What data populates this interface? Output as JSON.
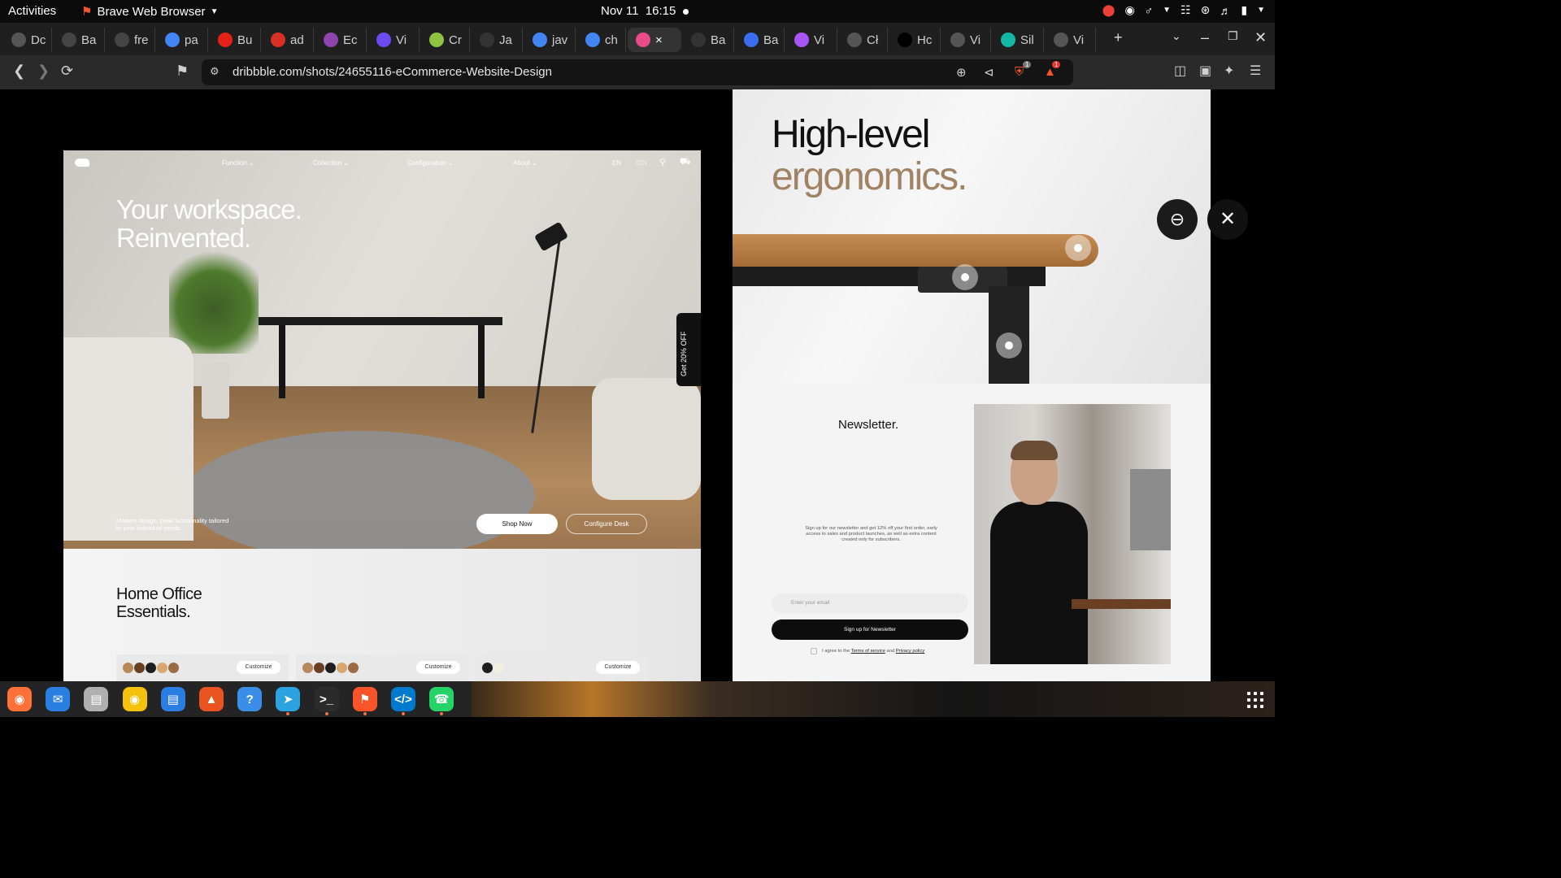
{
  "topbar": {
    "activities": "Activities",
    "app_name": "Brave Web Browser",
    "date": "Nov 11",
    "time": "16:15"
  },
  "tabs": [
    {
      "label": "Dc",
      "icon": "chatgpt-icon",
      "color": "#555555"
    },
    {
      "label": "Ba",
      "icon": "anthropic-icon",
      "color": "#444444"
    },
    {
      "label": "fre",
      "icon": "anthropic-icon",
      "color": "#444444"
    },
    {
      "label": "pa",
      "icon": "google-icon",
      "color": "#4285f4"
    },
    {
      "label": "Bu",
      "icon": "youtube-icon",
      "color": "#e62117"
    },
    {
      "label": "ad",
      "icon": "gmail-icon",
      "color": "#d93025"
    },
    {
      "label": "Ec",
      "icon": "orb-icon",
      "color": "#8e44ad"
    },
    {
      "label": "Vi",
      "icon": "shield-icon",
      "color": "#6c4cf1"
    },
    {
      "label": "Cr",
      "icon": "circle-icon",
      "color": "#8cc43f"
    },
    {
      "label": "Ja",
      "icon": "github-icon",
      "color": "#333333"
    },
    {
      "label": "jav",
      "icon": "google-icon",
      "color": "#4285f4"
    },
    {
      "label": "ch",
      "icon": "google-icon",
      "color": "#4285f4"
    },
    {
      "label": "×",
      "icon": "dribbble-icon",
      "color": "#ea4c89",
      "active": true
    },
    {
      "label": "Ba",
      "icon": "figure-icon",
      "color": "#333333"
    },
    {
      "label": "Ba",
      "icon": "form-icon",
      "color": "#3a6df0"
    },
    {
      "label": "Vi",
      "icon": "vite-icon",
      "color": "#a855f7"
    },
    {
      "label": "Cł",
      "icon": "chatgpt-icon",
      "color": "#555555"
    },
    {
      "label": "Hc",
      "icon": "x-icon",
      "color": "#000000"
    },
    {
      "label": "Vi",
      "icon": "globe-icon",
      "color": "#555555"
    },
    {
      "label": "Sil",
      "icon": "diamond-icon",
      "color": "#15b8a6"
    },
    {
      "label": "Vi",
      "icon": "globe-icon",
      "color": "#555555"
    }
  ],
  "address": {
    "url": "dribbble.com/shots/24655116-eCommerce-Website-Design",
    "brave_badge": "1",
    "alert_badge": "1"
  },
  "shot_left": {
    "nav": [
      "Function",
      "Collection",
      "Configuration",
      "About"
    ],
    "lang_en": "EN",
    "lang_idn": "IDN",
    "headline_1": "Your workspace.",
    "headline_2": "Reinvented.",
    "tagline": "Modern design, peak functionality tailored to your individual needs.",
    "shop_now": "Shop Now",
    "configure": "Configure Desk",
    "promo": "Get 20% OFF",
    "section_1": "Home Office",
    "section_2": "Essentials.",
    "customize": "Customize"
  },
  "shot_right": {
    "headline_1": "High-level",
    "headline_2": "ergonomics.",
    "newsletter": "Newsletter.",
    "desc": "Sign up for our newsletter and get 12% off your first order, early access to sales and product launches, as well as extra content created only for subscribers.",
    "email_placeholder": "Enter your email",
    "signup": "Sign up for Newsletter",
    "agree_prefix": "I agree to the",
    "terms": "Terms of service",
    "and": "and",
    "privacy": "Privacy policy"
  },
  "dock": [
    {
      "name": "firefox-icon",
      "color": "#ff7139"
    },
    {
      "name": "thunderbird-icon",
      "color": "#2a7de1"
    },
    {
      "name": "files-icon",
      "color": "#b0b0b0"
    },
    {
      "name": "rhythmbox-icon",
      "color": "#f4c20d"
    },
    {
      "name": "writer-icon",
      "color": "#2a7de1"
    },
    {
      "name": "app-center-icon",
      "color": "#e95420"
    },
    {
      "name": "help-icon",
      "color": "#3b8ee8"
    },
    {
      "name": "telegram-icon",
      "color": "#2aa3e0"
    },
    {
      "name": "terminal-icon",
      "color": "#2b2b2b"
    },
    {
      "name": "brave-icon",
      "color": "#fb542b"
    },
    {
      "name": "vscode-icon",
      "color": "#007acc"
    },
    {
      "name": "whatsapp-icon",
      "color": "#25d366"
    }
  ]
}
